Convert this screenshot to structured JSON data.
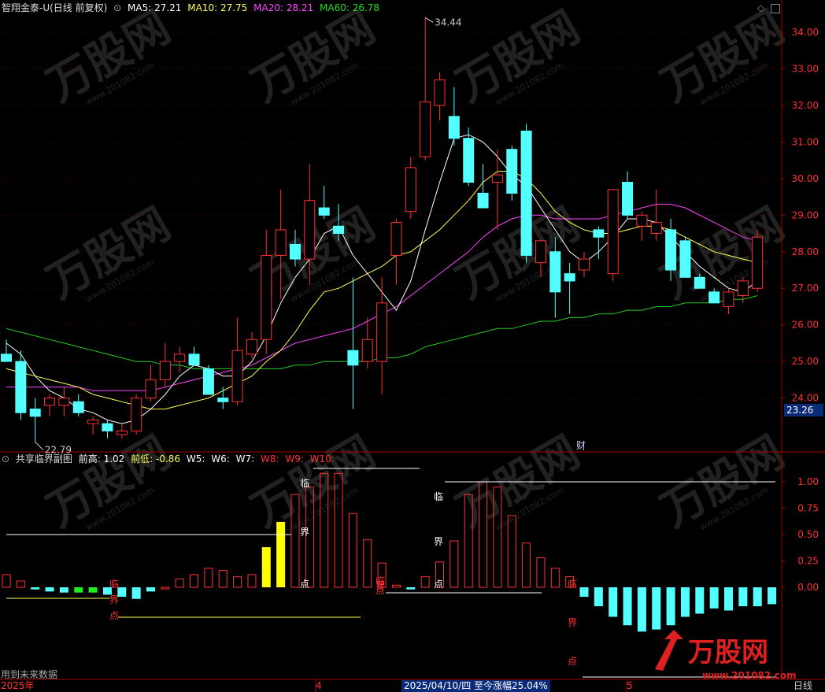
{
  "main_header": {
    "symbol": "智翔金泰-U(日线 前复权)",
    "ma5": "MA5: 27.21",
    "ma10": "MA10: 27.75",
    "ma20": "MA20: 28.21",
    "ma60": "MA60: 26.78"
  },
  "sub_header": {
    "indicator": "共享临界副图",
    "prev_high": "前高: 1.02",
    "prev_low_label": "前低:",
    "prev_low_value": "-0.86",
    "w5": "W5:",
    "w6": "W6:",
    "w7": "W7:",
    "w8": "W8:",
    "w9": "W9:",
    "w10": "W10:"
  },
  "price_axis_labels": [
    "34.00",
    "33.00",
    "32.00",
    "31.00",
    "30.00",
    "29.00",
    "28.00",
    "27.00",
    "26.00",
    "25.00",
    "24.00"
  ],
  "current_price_badge": "23.26",
  "sub_axis_labels": [
    "1.00",
    "0.75",
    "0.50",
    "0.25",
    "0.00"
  ],
  "annotations": {
    "high": "34.44",
    "low": "22.79",
    "finance_marker": "财",
    "critical_chars": [
      "临",
      "界",
      "点"
    ]
  },
  "footer": {
    "note": "用到未来数据",
    "year": "2025年",
    "month_4": "4",
    "date_info": "2025/04/10/四  至今涨幅25.04%",
    "month_5": "5",
    "period": "日线"
  },
  "watermark": {
    "text": "万股网",
    "url": "www.201082.com"
  },
  "colors": {
    "up": "#ff3030",
    "down": "#54ffff",
    "ma5": "#ffffff",
    "ma10": "#ffff55",
    "ma20": "#ff44ff",
    "ma60": "#22cc22",
    "yellow_bar": "#ffff00",
    "green_bar": "#22ee22",
    "axis_red": "#aa0000"
  },
  "chart_data": [
    {
      "type": "candlestick",
      "title": "智翔金泰-U(日线 前复权)",
      "ylim": [
        22.2,
        34.6
      ],
      "candles": [
        {
          "o": 25.2,
          "h": 25.6,
          "l": 25.0,
          "c": 25.0
        },
        {
          "o": 25.0,
          "h": 25.3,
          "l": 23.4,
          "c": 23.6
        },
        {
          "o": 23.7,
          "h": 24.0,
          "l": 22.8,
          "c": 23.5
        },
        {
          "o": 23.8,
          "h": 24.1,
          "l": 23.5,
          "c": 24.0
        },
        {
          "o": 23.8,
          "h": 24.3,
          "l": 23.5,
          "c": 24.0
        },
        {
          "o": 23.9,
          "h": 24.1,
          "l": 23.5,
          "c": 23.6
        },
        {
          "o": 23.3,
          "h": 23.5,
          "l": 23.0,
          "c": 23.4
        },
        {
          "o": 23.3,
          "h": 23.4,
          "l": 22.9,
          "c": 23.1
        },
        {
          "o": 23.0,
          "h": 23.3,
          "l": 22.9,
          "c": 23.1
        },
        {
          "o": 23.1,
          "h": 24.1,
          "l": 23.0,
          "c": 24.0
        },
        {
          "o": 24.0,
          "h": 24.9,
          "l": 23.9,
          "c": 24.5
        },
        {
          "o": 24.5,
          "h": 25.5,
          "l": 24.3,
          "c": 25.0
        },
        {
          "o": 25.0,
          "h": 25.4,
          "l": 24.7,
          "c": 25.2
        },
        {
          "o": 25.2,
          "h": 25.4,
          "l": 24.9,
          "c": 24.9
        },
        {
          "o": 24.8,
          "h": 24.9,
          "l": 24.1,
          "c": 24.1
        },
        {
          "o": 24.0,
          "h": 24.3,
          "l": 23.7,
          "c": 23.9
        },
        {
          "o": 23.9,
          "h": 26.2,
          "l": 23.8,
          "c": 25.3
        },
        {
          "o": 25.2,
          "h": 25.8,
          "l": 25.1,
          "c": 25.6
        },
        {
          "o": 25.6,
          "h": 28.6,
          "l": 25.2,
          "c": 27.9
        },
        {
          "o": 27.9,
          "h": 29.7,
          "l": 26.7,
          "c": 28.6
        },
        {
          "o": 28.2,
          "h": 28.6,
          "l": 27.6,
          "c": 27.8
        },
        {
          "o": 27.8,
          "h": 30.4,
          "l": 27.1,
          "c": 29.4
        },
        {
          "o": 29.2,
          "h": 29.8,
          "l": 28.9,
          "c": 29.0
        },
        {
          "o": 28.7,
          "h": 29.3,
          "l": 28.3,
          "c": 28.5
        },
        {
          "o": 25.3,
          "h": 27.3,
          "l": 23.7,
          "c": 24.9
        },
        {
          "o": 25.0,
          "h": 26.2,
          "l": 24.8,
          "c": 25.6
        },
        {
          "o": 25.0,
          "h": 27.3,
          "l": 24.1,
          "c": 26.6
        },
        {
          "o": 27.9,
          "h": 28.9,
          "l": 27.1,
          "c": 28.8
        },
        {
          "o": 29.1,
          "h": 30.6,
          "l": 28.9,
          "c": 30.3
        },
        {
          "o": 30.6,
          "h": 34.4,
          "l": 30.5,
          "c": 32.1
        },
        {
          "o": 32.0,
          "h": 32.9,
          "l": 31.6,
          "c": 32.7
        },
        {
          "o": 31.7,
          "h": 32.5,
          "l": 30.9,
          "c": 31.1
        },
        {
          "o": 31.1,
          "h": 31.4,
          "l": 29.8,
          "c": 29.9
        },
        {
          "o": 29.6,
          "h": 30.4,
          "l": 29.2,
          "c": 29.2
        },
        {
          "o": 29.9,
          "h": 30.8,
          "l": 28.6,
          "c": 30.1
        },
        {
          "o": 30.8,
          "h": 30.9,
          "l": 29.4,
          "c": 29.6
        },
        {
          "o": 31.3,
          "h": 31.5,
          "l": 27.7,
          "c": 27.9
        },
        {
          "o": 27.7,
          "h": 28.2,
          "l": 27.3,
          "c": 28.3
        },
        {
          "o": 28.0,
          "h": 28.4,
          "l": 26.2,
          "c": 26.9
        },
        {
          "o": 27.4,
          "h": 27.7,
          "l": 26.3,
          "c": 27.2
        },
        {
          "o": 27.5,
          "h": 28.0,
          "l": 27.3,
          "c": 27.8
        },
        {
          "o": 28.6,
          "h": 28.7,
          "l": 27.8,
          "c": 28.4
        },
        {
          "o": 27.4,
          "h": 29.6,
          "l": 27.2,
          "c": 29.7
        },
        {
          "o": 29.9,
          "h": 30.2,
          "l": 28.9,
          "c": 29.0
        },
        {
          "o": 28.7,
          "h": 29.1,
          "l": 28.3,
          "c": 29.0
        },
        {
          "o": 28.5,
          "h": 29.7,
          "l": 28.3,
          "c": 28.8
        },
        {
          "o": 28.6,
          "h": 28.9,
          "l": 27.2,
          "c": 27.5
        },
        {
          "o": 28.3,
          "h": 28.4,
          "l": 27.3,
          "c": 27.3
        },
        {
          "o": 27.3,
          "h": 27.4,
          "l": 27.0,
          "c": 27.0
        },
        {
          "o": 26.9,
          "h": 27.0,
          "l": 26.6,
          "c": 26.6
        },
        {
          "o": 26.5,
          "h": 27.0,
          "l": 26.3,
          "c": 26.9
        },
        {
          "o": 26.8,
          "h": 27.3,
          "l": 26.6,
          "c": 27.2
        },
        {
          "o": 27.0,
          "h": 28.6,
          "l": 26.9,
          "c": 28.4
        }
      ],
      "ma5": [
        25.5,
        25.2,
        24.6,
        24.2,
        24.0,
        23.7,
        23.6,
        23.4,
        23.3,
        23.4,
        23.7,
        24.1,
        24.6,
        24.9,
        24.8,
        24.6,
        24.6,
        25.0,
        25.7,
        26.6,
        27.3,
        27.8,
        28.5,
        28.7,
        27.9,
        27.4,
        26.9,
        26.4,
        27.2,
        28.6,
        29.9,
        31.1,
        31.2,
        31.0,
        30.6,
        30.1,
        29.8,
        29.2,
        28.6,
        28.0,
        27.7,
        28.0,
        28.4,
        28.9,
        28.9,
        28.8,
        28.4,
        28.0,
        27.6,
        27.3,
        27.0,
        26.9,
        27.2
      ],
      "ma10": [
        24.8,
        24.7,
        24.6,
        24.5,
        24.4,
        24.3,
        24.1,
        24.0,
        23.9,
        23.8,
        23.7,
        23.7,
        23.8,
        23.9,
        24.0,
        24.2,
        24.4,
        24.6,
        25.0,
        25.3,
        25.8,
        26.4,
        26.9,
        27.0,
        27.2,
        27.4,
        27.6,
        27.9,
        28.0,
        28.3,
        28.6,
        29.0,
        29.4,
        29.9,
        30.2,
        30.2,
        30.0,
        29.6,
        29.1,
        28.8,
        28.6,
        28.5,
        28.5,
        28.6,
        28.7,
        28.7,
        28.6,
        28.4,
        28.2,
        28.0,
        27.9,
        27.8,
        27.7
      ],
      "ma20": [
        24.3,
        24.3,
        24.3,
        24.3,
        24.3,
        24.3,
        24.2,
        24.2,
        24.2,
        24.2,
        24.2,
        24.3,
        24.4,
        24.5,
        24.6,
        24.7,
        24.8,
        24.9,
        25.1,
        25.3,
        25.5,
        25.6,
        25.7,
        25.8,
        25.9,
        26.1,
        26.3,
        26.5,
        26.8,
        27.1,
        27.4,
        27.7,
        28.0,
        28.4,
        28.7,
        28.9,
        29.0,
        29.0,
        28.9,
        28.9,
        28.9,
        28.9,
        29.0,
        29.1,
        29.2,
        29.3,
        29.3,
        29.2,
        29.0,
        28.8,
        28.6,
        28.4,
        28.3
      ],
      "ma60": [
        25.9,
        25.8,
        25.7,
        25.6,
        25.5,
        25.4,
        25.3,
        25.2,
        25.1,
        25.0,
        25.0,
        24.9,
        24.9,
        24.8,
        24.8,
        24.8,
        24.8,
        24.8,
        24.8,
        24.8,
        24.9,
        24.9,
        25.0,
        25.0,
        25.0,
        25.0,
        25.1,
        25.1,
        25.2,
        25.4,
        25.5,
        25.6,
        25.7,
        25.8,
        25.9,
        25.9,
        26.0,
        26.1,
        26.1,
        26.2,
        26.2,
        26.3,
        26.3,
        26.4,
        26.4,
        26.5,
        26.5,
        26.6,
        26.6,
        26.6,
        26.7,
        26.7,
        26.8
      ]
    },
    {
      "type": "bar",
      "title": "共享临界副图",
      "ylim": [
        -0.9,
        1.1
      ],
      "values": [
        0.12,
        0.06,
        -0.02,
        -0.04,
        -0.05,
        -0.05,
        -0.05,
        -0.07,
        -0.09,
        -0.11,
        -0.04,
        0.0,
        0.08,
        0.12,
        0.18,
        0.16,
        0.1,
        0.12,
        0.38,
        0.62,
        0.88,
        0.95,
        1.08,
        1.08,
        0.7,
        0.45,
        0.23,
        0.02,
        -0.02,
        0.1,
        0.24,
        0.44,
        0.88,
        1.0,
        0.95,
        0.68,
        0.42,
        0.28,
        0.18,
        0.1,
        -0.09,
        -0.18,
        -0.28,
        -0.36,
        -0.42,
        -0.4,
        -0.36,
        -0.28,
        -0.25,
        -0.2,
        -0.22,
        -0.18,
        -0.18,
        -0.16
      ],
      "ref_lines": [
        0.5,
        1.0
      ]
    }
  ]
}
